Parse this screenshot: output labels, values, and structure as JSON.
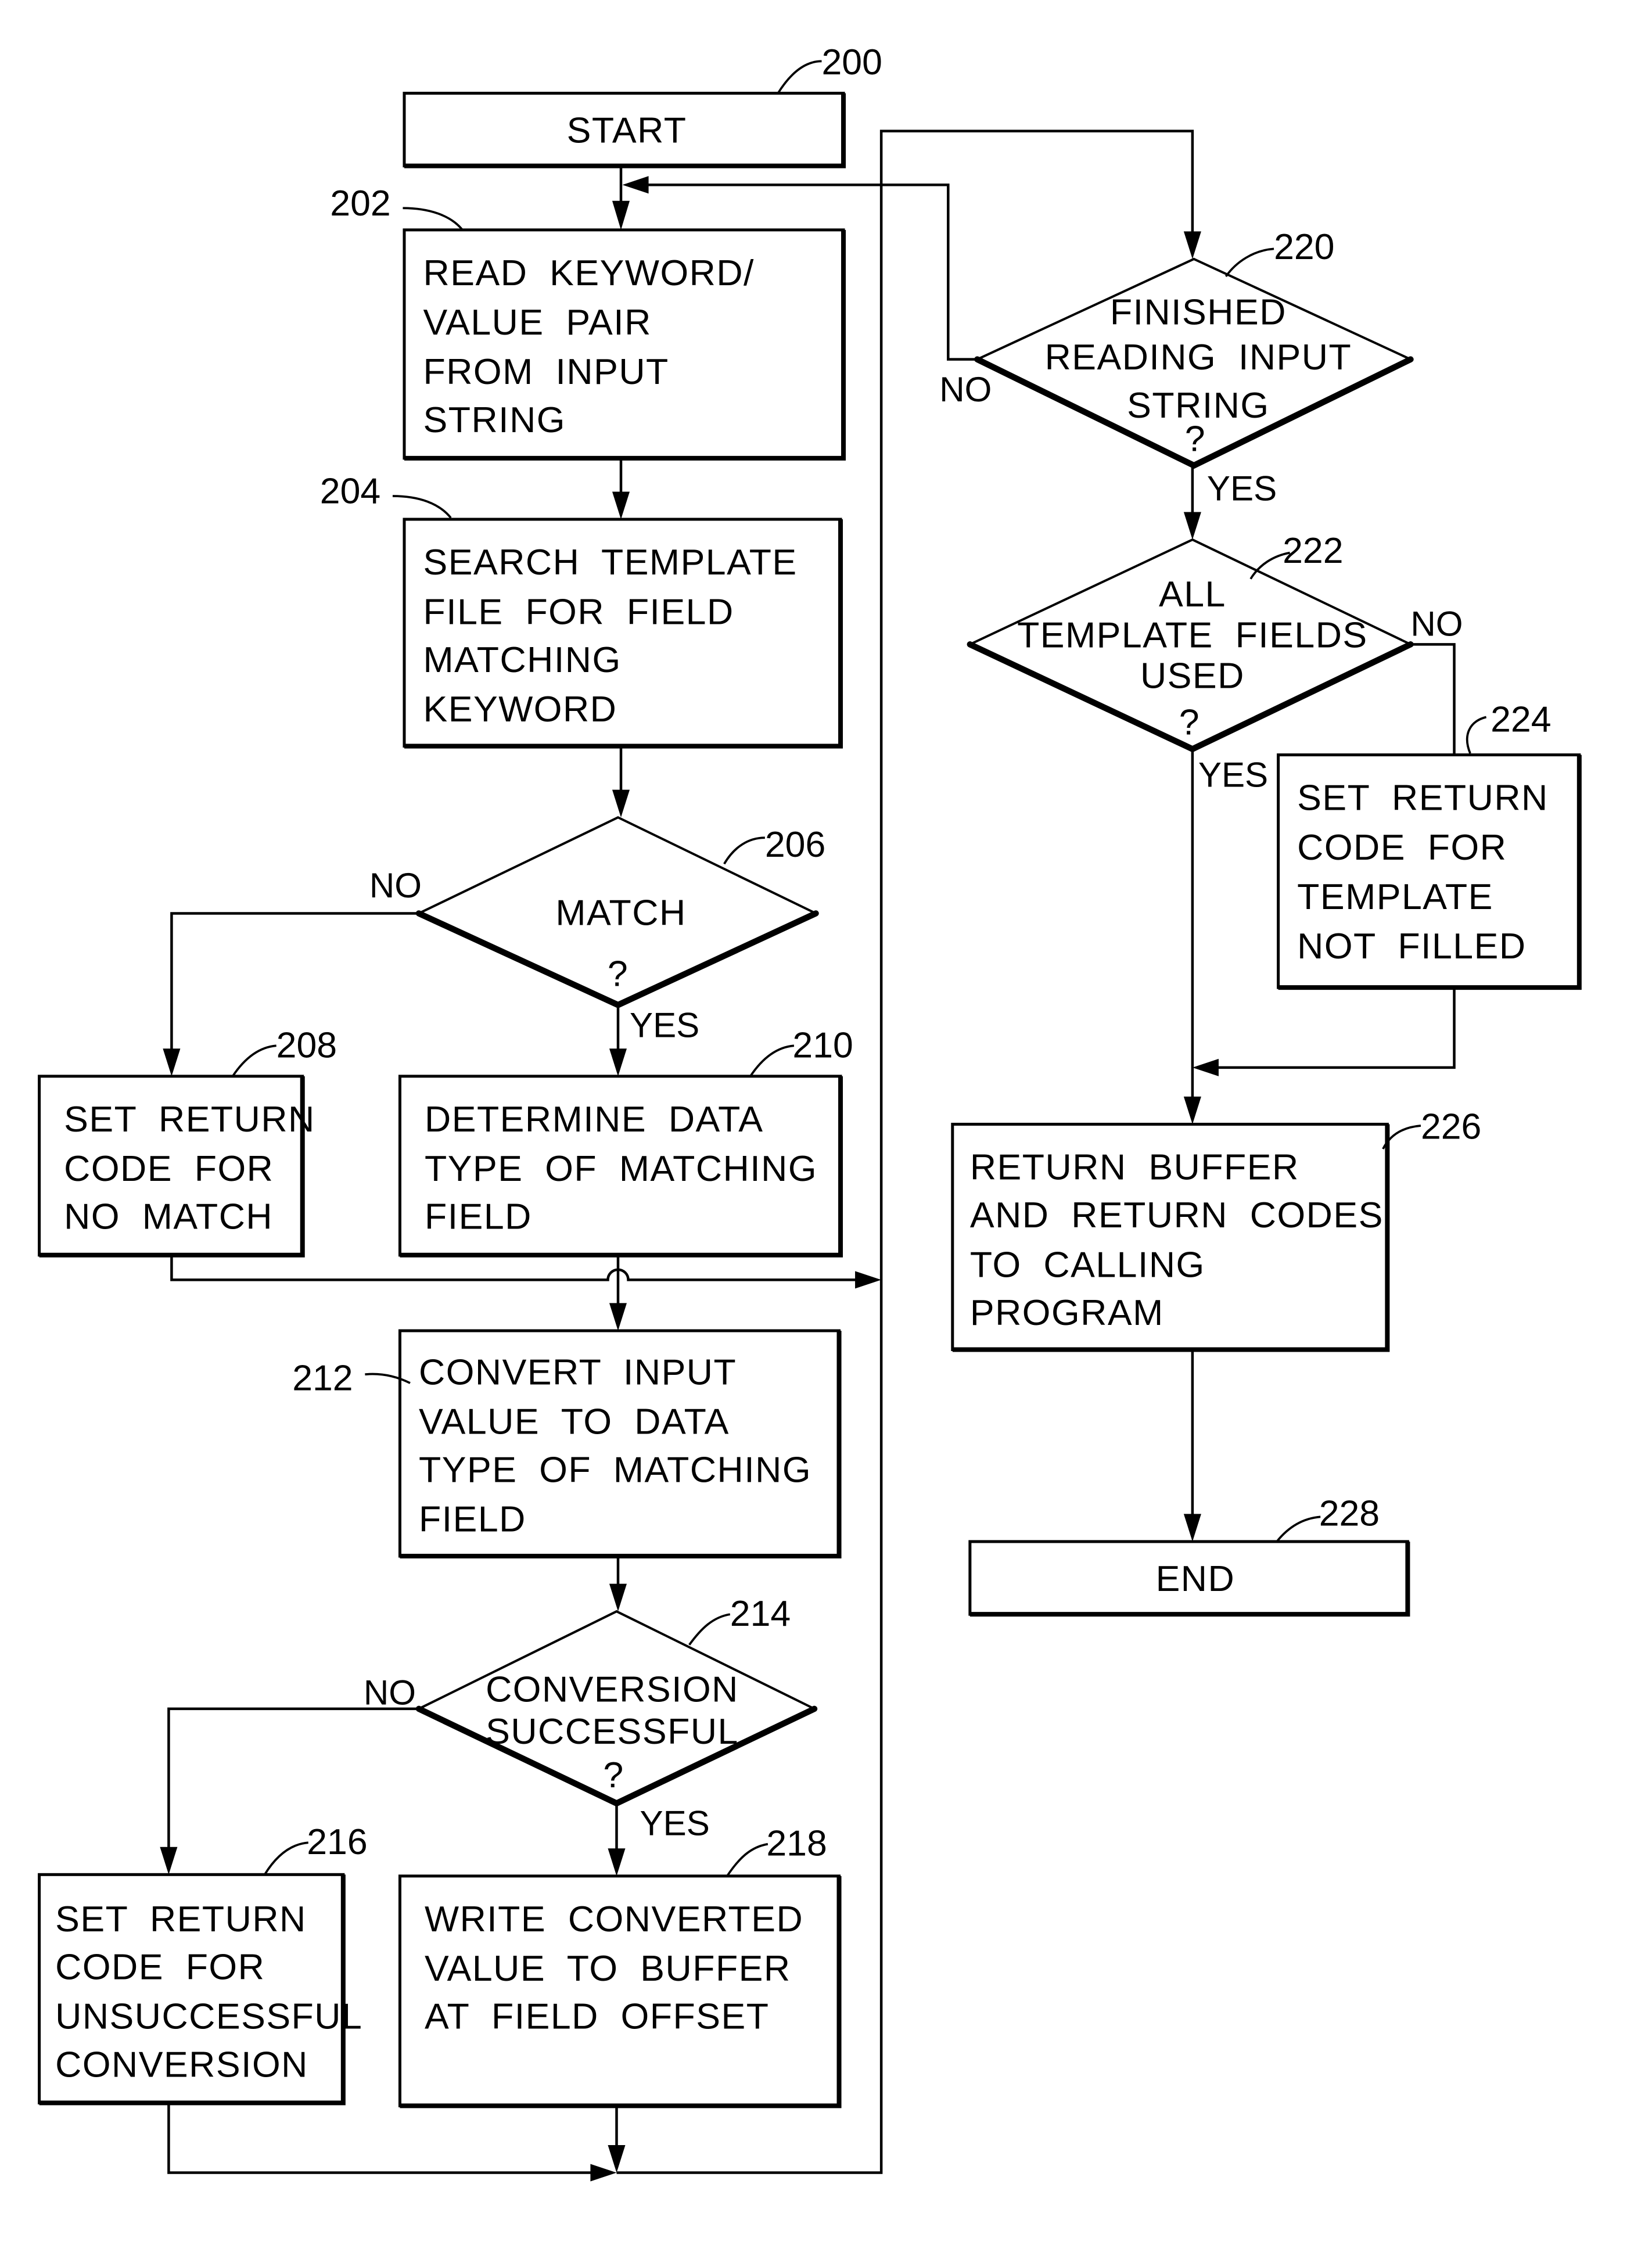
{
  "figure": {
    "nodes": {
      "start": {
        "ref": "200",
        "lines": [
          "START"
        ]
      },
      "read": {
        "ref": "202",
        "lines": [
          "READ  KEYWORD/",
          "VALUE  PAIR",
          "FROM  INPUT",
          "STRING"
        ]
      },
      "search": {
        "ref": "204",
        "lines": [
          "SEARCH  TEMPLATE",
          "FILE  FOR  FIELD",
          "MATCHING",
          "KEYWORD"
        ]
      },
      "match": {
        "ref": "206",
        "lines": [
          "MATCH"
        ],
        "question": "?"
      },
      "nomatch": {
        "ref": "208",
        "lines": [
          "SET  RETURN",
          "CODE  FOR",
          "NO  MATCH"
        ]
      },
      "dtype": {
        "ref": "210",
        "lines": [
          "DETERMINE  DATA",
          "TYPE  OF  MATCHING",
          "FIELD"
        ]
      },
      "convert": {
        "ref": "212",
        "lines": [
          "CONVERT  INPUT",
          "VALUE  TO  DATA",
          "TYPE  OF  MATCHING",
          "FIELD"
        ]
      },
      "convok": {
        "ref": "214",
        "lines": [
          "CONVERSION",
          "SUCCESSFUL"
        ],
        "question": "?"
      },
      "convbad": {
        "ref": "216",
        "lines": [
          "SET  RETURN",
          "CODE  FOR",
          "UNSUCCESSFUL",
          "CONVERSION"
        ]
      },
      "write": {
        "ref": "218",
        "lines": [
          "WRITE  CONVERTED",
          "VALUE  TO  BUFFER",
          "AT  FIELD  OFFSET"
        ]
      },
      "finished": {
        "ref": "220",
        "lines": [
          "FINISHED",
          "READING  INPUT",
          "STRING"
        ],
        "question": "?"
      },
      "allused": {
        "ref": "222",
        "lines": [
          "ALL",
          "TEMPLATE  FIELDS",
          "USED"
        ],
        "question": "?"
      },
      "notfill": {
        "ref": "224",
        "lines": [
          "SET  RETURN",
          "CODE  FOR",
          "TEMPLATE",
          "NOT  FILLED"
        ]
      },
      "ret": {
        "ref": "226",
        "lines": [
          "RETURN  BUFFER",
          "AND  RETURN  CODES",
          "TO  CALLING",
          "PROGRAM"
        ]
      },
      "end": {
        "ref": "228",
        "lines": [
          "END"
        ]
      }
    },
    "branch_labels": {
      "match_no": "NO",
      "match_yes": "YES",
      "convok_no": "NO",
      "convok_yes": "YES",
      "finished_no": "NO",
      "finished_yes": "YES",
      "allused_no": "NO",
      "allused_yes": "YES"
    }
  }
}
